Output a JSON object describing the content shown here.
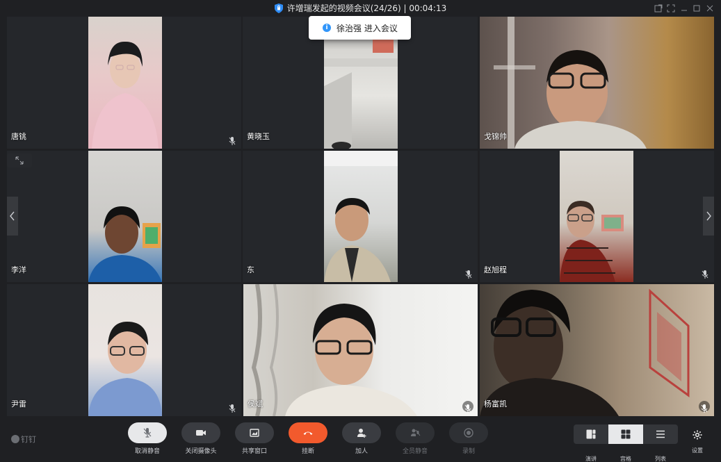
{
  "window": {
    "title": "许增瑞发起的视频会议(24/26) | 00:04:13"
  },
  "toast": {
    "message": "徐治强 进入会议"
  },
  "participants": [
    {
      "name": "唐铫"
    },
    {
      "name": "黄晓玉"
    },
    {
      "name": "戈锦帅"
    },
    {
      "name": "李洋"
    },
    {
      "name": "东"
    },
    {
      "name": "赵旭程"
    },
    {
      "name": "尹雷"
    },
    {
      "name": "侯斌"
    },
    {
      "name": "杨富凯"
    }
  ],
  "toolbar": {
    "logo": "钉钉",
    "unmute": "取消静音",
    "camera_off": "关闭摄像头",
    "share_window": "共享窗口",
    "hangup": "挂断",
    "add_person": "加人",
    "mute_all": "全员静音",
    "record": "录制",
    "view_speaker": "演讲",
    "view_grid": "宫格",
    "view_list": "列表",
    "settings": "设置"
  },
  "colors": {
    "hangup": "#f25a2d",
    "info": "#3296fa",
    "shield": "#2f8cf5"
  }
}
